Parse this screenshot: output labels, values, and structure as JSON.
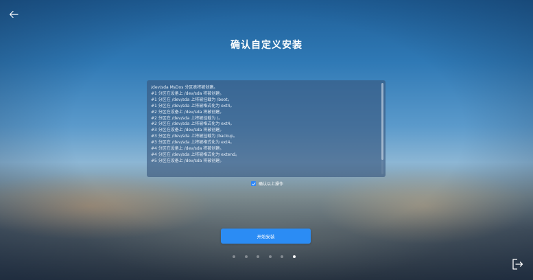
{
  "header": {
    "title": "确认自定义安装"
  },
  "log": {
    "lines": [
      "/dev/sda MsDos 分区表将被创建。",
      "#1 分区在设备上 /dev/sda 将被创建。",
      "#1 分区在 /dev/sda 上将被挂载为 /boot。",
      "#1 分区在 /dev/sda 上将被格式化为 ext4。",
      "#2 分区在设备上 /dev/sda 将被创建。",
      "#2 分区在 /dev/sda 上将被挂载为 /。",
      "#2 分区在 /dev/sda 上将被格式化为 ext4。",
      "#3 分区在设备上 /dev/sda 将被创建。",
      "#3 分区在 /dev/sda 上将被挂载为 /backup。",
      "#3 分区在 /dev/sda 上将被格式化为 ext4。",
      "#4 分区在设备上 /dev/sda 将被创建。",
      "#4 分区在 /dev/sda 上将被格式化为 extend。",
      "#5 分区在设备上 /dev/sda 将被创建。"
    ]
  },
  "confirm": {
    "label": "确认以上操作",
    "checked": true
  },
  "actions": {
    "install_label": "开始安装"
  },
  "pager": {
    "total": 6,
    "current": 6
  },
  "colors": {
    "accent": "#2b8cf4",
    "panel": "#37557d"
  },
  "icons": {
    "back": "arrow-left-icon",
    "exit": "exit-icon",
    "check": "check-icon"
  }
}
